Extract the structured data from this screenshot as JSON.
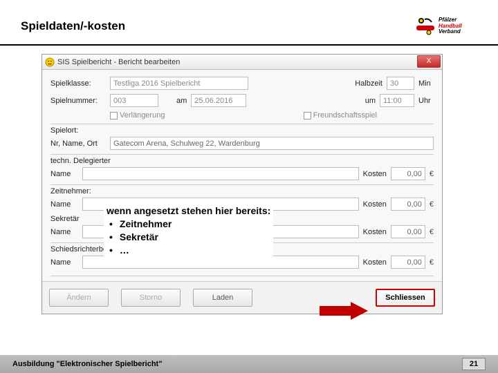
{
  "slide": {
    "title": "Spieldaten/-kosten",
    "footer": "Ausbildung \"Elektronischer Spielbericht\"",
    "page": "21"
  },
  "logo": {
    "line1": "Pfälzer",
    "line2": "Handball",
    "line3": "Verband"
  },
  "window": {
    "title": "SIS Spielbericht - Bericht bearbeiten",
    "close": "X"
  },
  "labels": {
    "spielklasse": "Spielklasse:",
    "halbzeit": "Halbzeit",
    "min": "Min",
    "spielnummer": "Spielnummer:",
    "am": "am",
    "um": "um",
    "uhr": "Uhr",
    "verlaengerung": "Verlängerung",
    "freundschaftsspiel": "Freundschaftsspiel",
    "spielort": "Spielort:",
    "nrNameOrt": "Nr, Name, Ort",
    "technDelegierter": "techn. Delegierter",
    "name": "Name",
    "kosten": "Kosten",
    "zeitnehmer": "Zeitnehmer:",
    "sekretaer": "Sekretär",
    "schiedsrichterbeobachter": "Schiedsrichterbeobachter:",
    "eur": "€"
  },
  "values": {
    "spielklasse": "Testliga 2016 Spielbericht",
    "halbzeit": "30",
    "spielnummer": "003",
    "datum": "25.06.2016",
    "uhrzeit": "11:00",
    "spielort": "Gatecom Arena, Schulweg 22, Wardenburg",
    "kosten": "0,00"
  },
  "buttons": {
    "aendern": "Ändern",
    "storno": "Storno",
    "laden": "Laden",
    "schliessen": "Schliessen"
  },
  "callout": {
    "heading": "wenn angesetzt stehen hier bereits:",
    "items": [
      "Zeitnehmer",
      "Sekretär",
      "…"
    ]
  }
}
